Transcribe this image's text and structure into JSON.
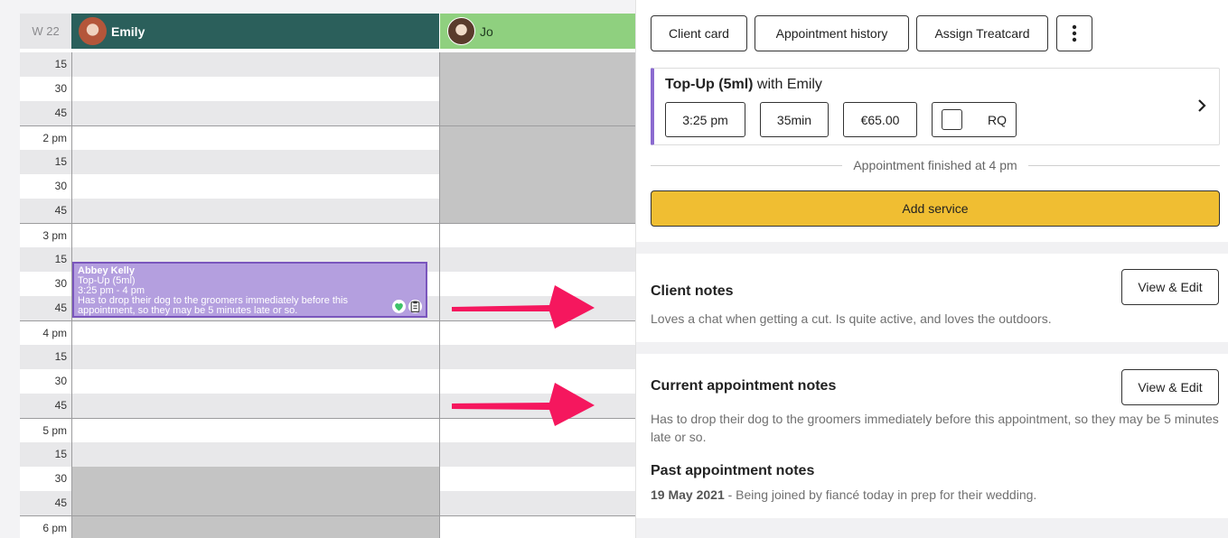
{
  "calendar": {
    "week_label": "W 22",
    "staff": [
      {
        "name": "Emily"
      },
      {
        "name": "Jo"
      }
    ],
    "time_labels": [
      "15",
      "30",
      "45",
      "2 pm",
      "15",
      "30",
      "45",
      "3 pm",
      "15",
      "30",
      "45",
      "4 pm",
      "15",
      "30",
      "45",
      "5 pm",
      "15",
      "30",
      "45",
      "6 pm"
    ],
    "appointment": {
      "client": "Abbey Kelly",
      "service": "Top-Up (5ml)",
      "time": "3:25 pm - 4 pm",
      "note": "Has to drop their dog to the groomers immediately before this appointment, so they may be 5 minutes late or so.",
      "color": "#b49fdf"
    }
  },
  "panel": {
    "buttons": {
      "client_card": "Client card",
      "appointment_history": "Appointment history",
      "assign_treatcard": "Assign Treatcard",
      "more_icon": "more-vertical-icon"
    },
    "service": {
      "name": "Top-Up (5ml)",
      "with_text": "with Emily",
      "start_time": "3:25 pm",
      "duration": "35min",
      "price": "€65.00",
      "rq_label": "RQ"
    },
    "finished_text": "Appointment finished at 4 pm",
    "add_service_label": "Add service",
    "client_notes": {
      "title": "Client notes",
      "edit_label": "View & Edit",
      "text": "Loves a chat when getting a cut. Is quite active, and loves the outdoors."
    },
    "current_notes": {
      "title": "Current appointment notes",
      "edit_label": "View & Edit",
      "text": "Has to drop their dog to the groomers immediately before this appointment, so they may be 5 minutes late or so."
    },
    "past_notes": {
      "title": "Past appointment notes",
      "date": "19 May 2021",
      "text": "- Being joined by fiancé today in prep for their wedding."
    }
  },
  "colors": {
    "emily_header": "#2b5f5b",
    "jo_header": "#8fd07f",
    "accent_yellow": "#f0be32",
    "arrow_pink": "#f5175e",
    "service_accent": "#8b6bd0"
  }
}
